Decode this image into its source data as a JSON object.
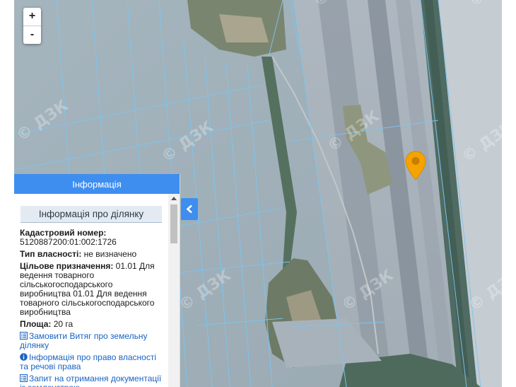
{
  "map": {
    "zoom_in_label": "+",
    "zoom_out_label": "-",
    "watermark_text": "© ДЗК"
  },
  "panel": {
    "header": "Інформація",
    "section_title": "Інформація про ділянку",
    "cadastral_label": "Кадастровий номер:",
    "cadastral_value": "5120887200:01:002:1726",
    "ownership_label": "Тип власності:",
    "ownership_value": " не визначено",
    "purpose_label": "Цільове призначення:",
    "purpose_value": " 01.01 Для ведення товарного сільськогосподарського виробництва 01.01 Для ведення товарного сільськогосподарського виробництва",
    "area_label": "Площа:",
    "area_value": " 20 га",
    "link_extract": "Замовити Витяг про земельну ділянку",
    "link_rights": "Інформація про право власності та речові права",
    "link_docs": "Запит на отримання документації із землеустрою"
  },
  "colors": {
    "header_blue": "#3e8ef0",
    "link_blue": "#1a63c4",
    "marker_orange": "#f5a300",
    "parcel_lines": "#7cc6f0"
  },
  "icons": {
    "zoom_in": "plus-icon",
    "zoom_out": "minus-icon",
    "marker": "map-pin-icon",
    "collapse": "chevron-left-icon",
    "extract": "list-icon",
    "rights": "info-circle-icon",
    "docs": "list-icon"
  }
}
